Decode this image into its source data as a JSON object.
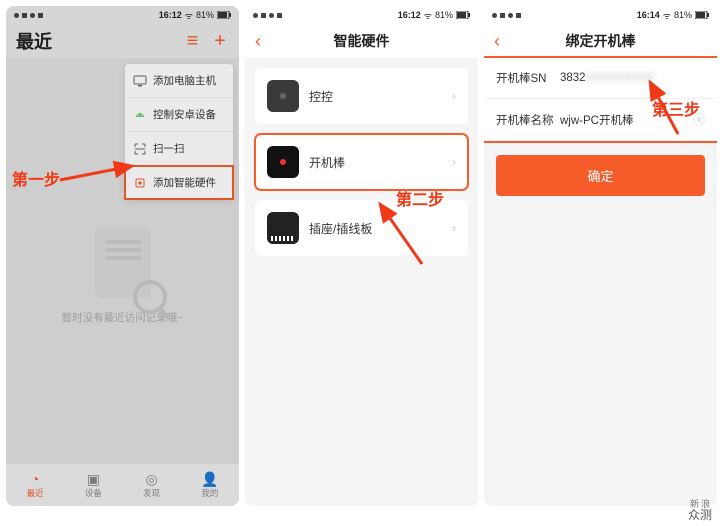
{
  "status": {
    "time1": "16:12",
    "time2": "16:12",
    "time3": "16:14",
    "battery": "81%"
  },
  "phone1": {
    "title": "最近",
    "menu": {
      "items": [
        {
          "label": "添加电脑主机"
        },
        {
          "label": "控制安卓设备"
        },
        {
          "label": "扫一扫"
        },
        {
          "label": "添加智能硬件"
        }
      ]
    },
    "empty_text": "暂时没有最近访问记录哦~",
    "tabs": [
      {
        "label": "最近"
      },
      {
        "label": "设备"
      },
      {
        "label": "发现"
      },
      {
        "label": "我的"
      }
    ]
  },
  "phone2": {
    "title": "智能硬件",
    "items": [
      {
        "label": "控控"
      },
      {
        "label": "开机棒"
      },
      {
        "label": "插座/插线板"
      }
    ]
  },
  "phone3": {
    "title": "绑定开机棒",
    "rows": {
      "sn_label": "开机棒SN",
      "sn_value_prefix": "3832",
      "sn_value_blur": "XXXXXXXXX",
      "name_label": "开机棒名称",
      "name_value": "wjw-PC开机棒"
    },
    "confirm": "确定"
  },
  "annotations": {
    "step1": "第一步",
    "step2": "第二步",
    "step3": "第三步"
  },
  "watermark": {
    "small": "新浪",
    "big": "众测"
  }
}
